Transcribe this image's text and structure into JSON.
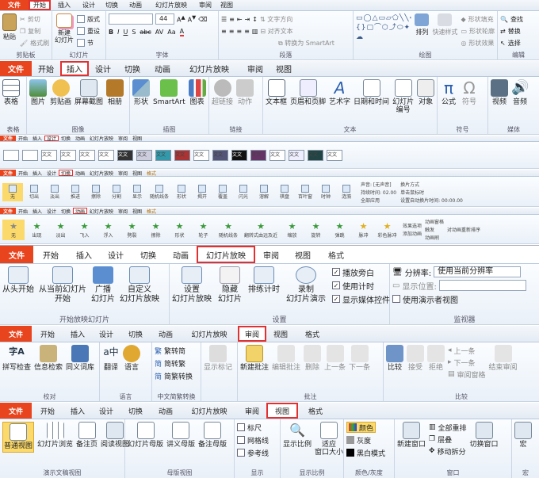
{
  "p1": {
    "tabs": [
      "文件",
      "开始",
      "插入",
      "设计",
      "切换",
      "动画",
      "幻灯片放映",
      "审阅",
      "视图"
    ],
    "active": "开始",
    "clipboard": {
      "paste": "粘贴",
      "cut": "剪切",
      "copy": "复制",
      "painter": "格式刷",
      "name": "剪贴板"
    },
    "slides": {
      "new": "新建\n幻灯片",
      "layout": "版式",
      "reset": "重设",
      "section": "节",
      "name": "幻灯片"
    },
    "font": {
      "size": "44",
      "name": "字体"
    },
    "para": {
      "dir": "文字方向",
      "align": "对齐文本",
      "smartart": "转换为 SmartArt",
      "name": "段落"
    },
    "drawing": {
      "arrange": "排列",
      "quick": "快速样式",
      "fill": "形状填充",
      "outline": "形状轮廓",
      "effects": "形状效果",
      "name": "绘图"
    },
    "editing": {
      "find": "查找",
      "replace": "替换",
      "select": "选择",
      "name": "编辑"
    }
  },
  "p2": {
    "tabs": [
      "文件",
      "开始",
      "插入",
      "设计",
      "切换",
      "动画",
      "幻灯片放映",
      "审阅",
      "视图"
    ],
    "active": "插入",
    "groups": [
      {
        "name": "表格",
        "items": [
          "表格"
        ]
      },
      {
        "name": "图像",
        "items": [
          "图片",
          "剪贴画",
          "屏幕截图",
          "相册"
        ]
      },
      {
        "name": "插图",
        "items": [
          "形状",
          "SmartArt",
          "图表"
        ]
      },
      {
        "name": "链接",
        "items": [
          "超链接",
          "动作"
        ]
      },
      {
        "name": "文本",
        "items": [
          "文本框",
          "页眉和页脚",
          "艺术字",
          "日期和时间",
          "幻灯片\n编号",
          "对象"
        ]
      },
      {
        "name": "符号",
        "items": [
          "公式",
          "符号"
        ]
      },
      {
        "name": "媒体",
        "items": [
          "视频",
          "音频"
        ]
      }
    ]
  },
  "p3": {
    "tabs": [
      "文件",
      "开始",
      "插入",
      "设计",
      "切换",
      "动画",
      "幻灯片放映",
      "审阅",
      "视图"
    ],
    "active": "设计",
    "themes": [
      "文文",
      "文文",
      "文文",
      "文文",
      "文文",
      "文文",
      "文文",
      "文文",
      "文文",
      "文文",
      "文文",
      "文文",
      "文文",
      "文文",
      "文文",
      "文文"
    ]
  },
  "p4": {
    "tabs": [
      "文件",
      "开始",
      "插入",
      "设计",
      "切换",
      "动画",
      "幻灯片放映",
      "审阅",
      "视图",
      "格式"
    ],
    "active": "切换",
    "items": [
      "无",
      "切出",
      "淡出",
      "推进",
      "擦除",
      "分割",
      "显示",
      "随机线条",
      "形状",
      "揭开",
      "覆盖",
      "闪光",
      "溶解",
      "棋盘",
      "百叶窗",
      "时钟",
      "涟漪"
    ],
    "timing": [
      "声音: [无声音]",
      "持续时间: 02.00",
      "全部应用",
      "换片方式",
      "单击鼠标时",
      "设置自动换片时间: 00:00.00"
    ]
  },
  "p5": {
    "tabs": [
      "文件",
      "开始",
      "插入",
      "设计",
      "切换",
      "动画",
      "幻灯片放映",
      "审阅",
      "视图",
      "格式"
    ],
    "active": "动画",
    "items": [
      "无",
      "出现",
      "淡出",
      "飞入",
      "浮入",
      "劈裂",
      "擦除",
      "形状",
      "轮子",
      "随机线条",
      "翻转式由远及近",
      "缩放",
      "旋转",
      "弹跳",
      "脉冲",
      "彩色脉冲"
    ],
    "right": [
      "效果选项",
      "添加动画",
      "动画窗格",
      "触发",
      "动画刷",
      "对动画重新排序"
    ]
  },
  "p6": {
    "tabs": [
      "文件",
      "开始",
      "插入",
      "设计",
      "切换",
      "动画",
      "幻灯片放映",
      "审阅",
      "视图",
      "格式"
    ],
    "active": "幻灯片放映",
    "start": {
      "name": "开始放映幻灯片",
      "items": [
        "从头开始",
        "从当前幻灯片\n开始",
        "广播\n幻灯片",
        "自定义\n幻灯片放映"
      ]
    },
    "setup": {
      "name": "设置",
      "items": [
        "设置\n幻灯片放映",
        "隐藏\n幻灯片",
        "排练计时",
        "录制\n幻灯片演示"
      ],
      "checks": [
        "播放旁白",
        "使用计时",
        "显示媒体控件"
      ]
    },
    "monitor": {
      "name": "监视器",
      "res_label": "分辨率:",
      "res_value": "使用当前分辨率",
      "pos_label": "显示位置:",
      "presenter": "使用演示者视图"
    }
  },
  "p7": {
    "tabs": [
      "文件",
      "开始",
      "插入",
      "设计",
      "切换",
      "动画",
      "幻灯片放映",
      "审阅",
      "视图",
      "格式"
    ],
    "active": "审阅",
    "proof": {
      "name": "校对",
      "items": [
        "拼写检查",
        "信息检索",
        "同义词库"
      ]
    },
    "lang": {
      "name": "语言",
      "items": [
        "翻译",
        "语言"
      ]
    },
    "cn": {
      "name": "中文简繁转换",
      "items": [
        "繁转简",
        "简转繁",
        "简繁转换"
      ]
    },
    "show": {
      "items": [
        "显示标记"
      ]
    },
    "comments": {
      "name": "批注",
      "items": [
        "新建批注",
        "编辑批注",
        "删除",
        "上一条",
        "下一条"
      ]
    },
    "compare": {
      "name": "比较",
      "items": [
        "比较",
        "接受",
        "拒绝",
        "上一条",
        "下一条",
        "审阅窗格",
        "结束审阅"
      ]
    }
  },
  "p8": {
    "tabs": [
      "文件",
      "开始",
      "插入",
      "设计",
      "切换",
      "动画",
      "幻灯片放映",
      "审阅",
      "视图",
      "格式"
    ],
    "active": "视图",
    "pv": {
      "name": "演示文稿视图",
      "items": [
        "普通视图",
        "幻灯片浏览",
        "备注页",
        "阅读视图"
      ]
    },
    "mv": {
      "name": "母版视图",
      "items": [
        "幻灯片母版",
        "讲义母版",
        "备注母版"
      ]
    },
    "show": {
      "name": "显示",
      "items": [
        "标尺",
        "网格线",
        "参考线"
      ]
    },
    "zoom": {
      "name": "显示比例",
      "items": [
        "显示比例",
        "适应\n窗口大小"
      ]
    },
    "color": {
      "name": "颜色/灰度",
      "items": [
        "颜色",
        "灰度",
        "黑白模式"
      ]
    },
    "window": {
      "name": "窗口",
      "items": [
        "新建窗口",
        "全部重排",
        "层叠",
        "移动拆分",
        "切换窗口"
      ]
    },
    "macro": {
      "name": "宏",
      "items": [
        "宏"
      ]
    }
  }
}
